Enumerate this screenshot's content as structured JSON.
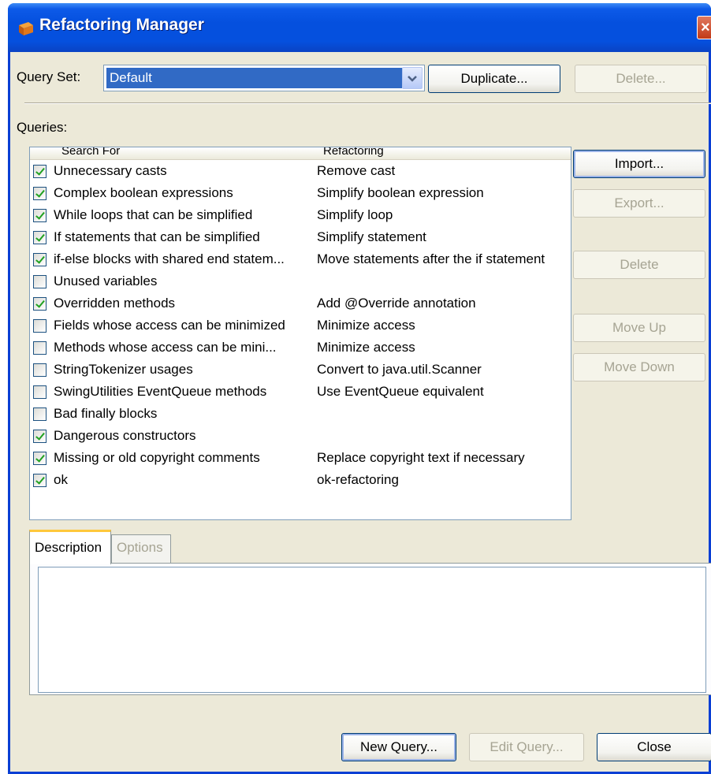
{
  "window": {
    "title": "Refactoring Manager"
  },
  "query_set": {
    "label": "Query Set:",
    "selected": "Default",
    "duplicate_label": "Duplicate...",
    "delete_label": "Delete..."
  },
  "queries": {
    "label": "Queries:",
    "columns": [
      "Search For",
      "Refactoring"
    ],
    "rows": [
      {
        "checked": true,
        "search": "Unnecessary casts",
        "refactoring": "Remove cast"
      },
      {
        "checked": true,
        "search": "Complex boolean expressions",
        "refactoring": "Simplify boolean expression"
      },
      {
        "checked": true,
        "search": "While loops that can be simplified",
        "refactoring": "Simplify loop"
      },
      {
        "checked": true,
        "search": "If statements that can be simplified",
        "refactoring": "Simplify statement"
      },
      {
        "checked": true,
        "search": "if-else blocks with shared end statem...",
        "refactoring": "Move statements after the if statement"
      },
      {
        "checked": false,
        "search": "Unused variables",
        "refactoring": ""
      },
      {
        "checked": true,
        "search": "Overridden methods",
        "refactoring": "Add @Override annotation"
      },
      {
        "checked": false,
        "search": "Fields whose access can be minimized",
        "refactoring": "Minimize access"
      },
      {
        "checked": false,
        "search": "Methods whose access can be mini...",
        "refactoring": "Minimize access"
      },
      {
        "checked": false,
        "search": "StringTokenizer usages",
        "refactoring": "Convert to java.util.Scanner"
      },
      {
        "checked": false,
        "search": "SwingUtilities EventQueue methods",
        "refactoring": "Use EventQueue equivalent"
      },
      {
        "checked": false,
        "search": "Bad finally blocks",
        "refactoring": ""
      },
      {
        "checked": true,
        "search": "Dangerous constructors",
        "refactoring": ""
      },
      {
        "checked": true,
        "search": "Missing or old copyright comments",
        "refactoring": "Replace copyright text if necessary"
      },
      {
        "checked": true,
        "search": "ok",
        "refactoring": "ok-refactoring"
      }
    ]
  },
  "side_buttons": {
    "import": "Import...",
    "export": "Export...",
    "delete": "Delete",
    "move_up": "Move Up",
    "move_down": "Move Down"
  },
  "tabs": {
    "description": "Description",
    "options": "Options"
  },
  "description_text": "",
  "footer": {
    "new_query": "New Query...",
    "edit_query": "Edit Query...",
    "close": "Close"
  },
  "colors": {
    "titlebar": "#0550de",
    "selection": "#316ac5",
    "dialog": "#ece9d8"
  },
  "icons": {
    "title": "app-icon",
    "close": "close-icon",
    "dropdown": "chevron-down-icon",
    "check": "check-icon"
  }
}
